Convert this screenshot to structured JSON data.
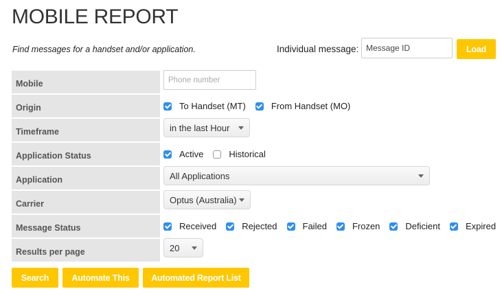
{
  "page": {
    "title": "MOBILE REPORT",
    "subtitle": "Find messages for a handset and/or application."
  },
  "individual": {
    "label": "Individual message:",
    "value": "",
    "placeholder": "Message ID",
    "load_label": "Load"
  },
  "form": {
    "mobile": {
      "label": "Mobile",
      "value": "",
      "placeholder": "Phone number"
    },
    "origin": {
      "label": "Origin",
      "options": [
        {
          "label": "To Handset (MT)",
          "checked": true
        },
        {
          "label": "From Handset (MO)",
          "checked": true
        }
      ]
    },
    "timeframe": {
      "label": "Timeframe",
      "selected": "in the last Hour"
    },
    "application_status": {
      "label": "Application Status",
      "options": [
        {
          "label": "Active",
          "checked": true
        },
        {
          "label": "Historical",
          "checked": false
        }
      ]
    },
    "application": {
      "label": "Application",
      "selected": "All Applications"
    },
    "carrier": {
      "label": "Carrier",
      "selected": "Optus (Australia)"
    },
    "message_status": {
      "label": "Message Status",
      "options": [
        {
          "label": "Received",
          "checked": true
        },
        {
          "label": "Rejected",
          "checked": true
        },
        {
          "label": "Failed",
          "checked": true
        },
        {
          "label": "Frozen",
          "checked": true
        },
        {
          "label": "Deficient",
          "checked": true
        },
        {
          "label": "Expired",
          "checked": true
        }
      ]
    },
    "results_per_page": {
      "label": "Results per page",
      "selected": "20"
    }
  },
  "actions": {
    "search_label": "Search",
    "automate_label": "Automate This",
    "report_list_label": "Automated Report List"
  },
  "colors": {
    "accent": "#ffc700",
    "checkbox": "#2d8ef5",
    "label_bg": "#e5e5e5"
  }
}
